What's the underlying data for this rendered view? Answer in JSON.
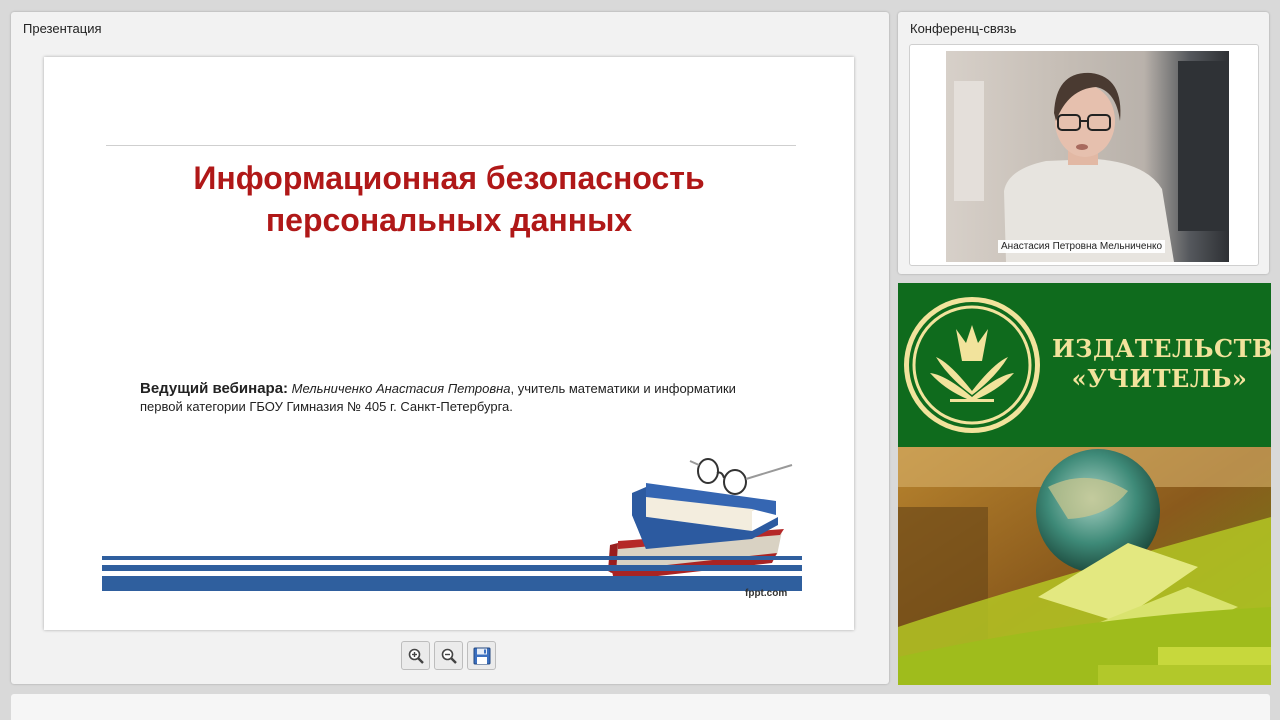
{
  "presentation": {
    "panel_title": "Презентация",
    "slide": {
      "title_line1": "Информационная безопасность",
      "title_line2": "персональных данных",
      "presenter_label": "Ведущий вебинара:",
      "presenter_name": "Мельниченко Анастасия Петровна",
      "presenter_desc": ", учитель математики и информатики первой категории ГБОУ Гимназия № 405 г. Санкт-Петербурга.",
      "footer_credit": "fppt.com"
    },
    "tools": [
      {
        "name": "zoom-in",
        "icon": "zoom-in-icon"
      },
      {
        "name": "zoom-out",
        "icon": "zoom-out-icon"
      },
      {
        "name": "save",
        "icon": "floppy-disk-icon"
      }
    ]
  },
  "conference": {
    "panel_title": "Конференц-связь",
    "participant_name": "Анастасия Петровна Мельниченко"
  },
  "banner": {
    "publisher_line1": "ИЗДАТЕЛЬСТВО",
    "publisher_line2": "«УЧИТЕЛЬ»"
  },
  "colors": {
    "title_red": "#b01818",
    "stripe_blue": "#2f5f9e",
    "banner_green": "#0f6b1d",
    "banner_gold": "#f2e39c"
  }
}
